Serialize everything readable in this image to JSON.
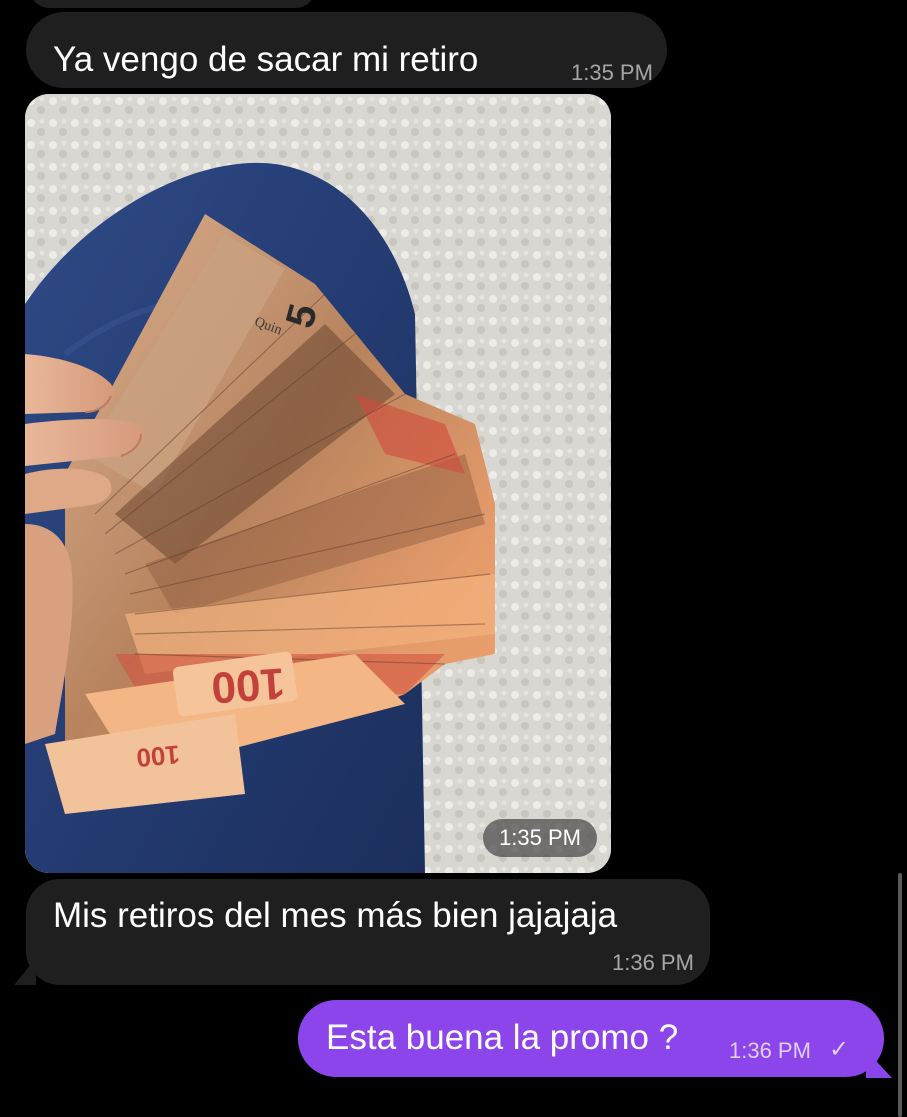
{
  "messages": [
    {
      "text": "Ya vengo de sacar mi retiro",
      "time": "1:35 PM",
      "direction": "incoming"
    },
    {
      "type": "photo",
      "time": "1:35 PM",
      "direction": "incoming",
      "banknote_labels": [
        "5",
        "Quin",
        "100",
        "100"
      ]
    },
    {
      "text": "Mis retiros del mes más bien jajajaja",
      "time": "1:36 PM",
      "direction": "incoming"
    },
    {
      "text": "Esta buena la promo ?",
      "time": "1:36 PM",
      "status_icon": "checkmark-icon",
      "status_glyph": "✓",
      "direction": "outgoing"
    }
  ],
  "colors": {
    "background": "#000000",
    "incoming_bubble": "#1f1f1f",
    "outgoing_bubble": "#8b45ea",
    "timestamp_incoming": "#a6a6a6",
    "timestamp_outgoing": "#ded0fb"
  }
}
